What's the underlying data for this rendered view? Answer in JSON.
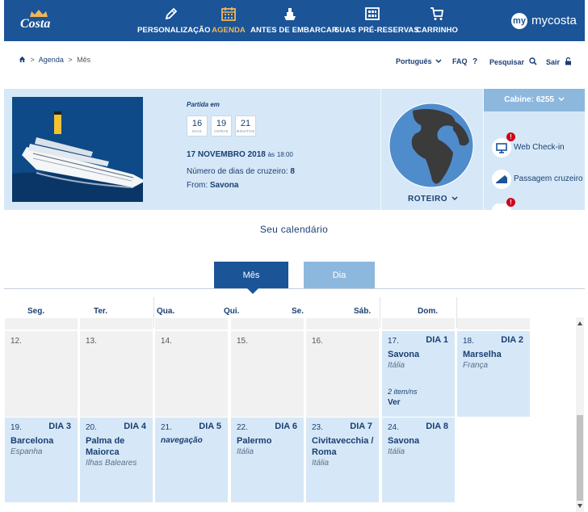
{
  "header": {
    "logo_text": "Costa",
    "nav": [
      {
        "label": "PERSONALIZAÇÃO",
        "icon": "pencil-icon"
      },
      {
        "label": "AGENDA",
        "icon": "calendar-icon",
        "active": true
      },
      {
        "label": "ANTES DE EMBARCAR",
        "icon": "ship-icon"
      },
      {
        "label": "SUAS PRÉ-RESERVAS",
        "icon": "grid-icon"
      },
      {
        "label": "CARRINHO",
        "icon": "cart-icon"
      }
    ],
    "mycosta_badge": "my",
    "mycosta_label": "mycosta"
  },
  "breadcrumb": {
    "home_icon": "home-icon",
    "items": [
      "Agenda",
      "Mês"
    ],
    "separator": ">"
  },
  "utility": {
    "language": "Português",
    "faq": "FAQ",
    "search": "Pesquisar",
    "logout": "Sair"
  },
  "cruise": {
    "departure_label": "Partida em",
    "countdown": [
      {
        "value": "16",
        "unit": "DIAS"
      },
      {
        "value": "19",
        "unit": "HORAS"
      },
      {
        "value": "21",
        "unit": "MINUTOS"
      }
    ],
    "date": "17 NOVEMBRO 2018",
    "time_prefix": "às",
    "time": "18:00",
    "days_label": "Número de dias de cruzeiro:",
    "days_value": "8",
    "from_label": "From:",
    "from_value": "Savona",
    "route_label": "ROTEIRO"
  },
  "cabin": {
    "title": "Cabine: 6255",
    "items": [
      {
        "label": "Web Check-in",
        "icon": "monitor-icon",
        "alert": "!"
      },
      {
        "label": "Passagem cruzeiro",
        "icon": "ticket-icon"
      },
      {
        "label": "",
        "icon": "document-icon",
        "alert": "!"
      }
    ]
  },
  "calendar": {
    "title": "Seu calendário",
    "tabs": [
      "Mês",
      "Dia"
    ],
    "weekdays": [
      "Seg.",
      "Ter.",
      "Qua.",
      "Qui.",
      "Se.",
      "Sáb.",
      "Dom."
    ],
    "week1": [
      {
        "date": "12."
      },
      {
        "date": "13."
      },
      {
        "date": "14."
      },
      {
        "date": "15."
      },
      {
        "date": "16."
      },
      {
        "date": "17.",
        "day": "DIA 1",
        "city": "Savona",
        "country": "Itália",
        "items": "2 item/ns",
        "link": "Ver"
      },
      {
        "date": "18.",
        "day": "DIA 2",
        "city": "Marselha",
        "country": "França"
      }
    ],
    "week2": [
      {
        "date": "19.",
        "day": "DIA 3",
        "city": "Barcelona",
        "country": "Espanha"
      },
      {
        "date": "20.",
        "day": "DIA 4",
        "city": "Palma de Maiorca",
        "country": "Ilhas Baleares"
      },
      {
        "date": "21.",
        "day": "DIA 5",
        "note": "navegação"
      },
      {
        "date": "22.",
        "day": "DIA 6",
        "city": "Palermo",
        "country": "Itália"
      },
      {
        "date": "23.",
        "day": "DIA 7",
        "city": "Civitavecchia / Roma",
        "country": "Itália"
      },
      {
        "date": "24.",
        "day": "DIA 8",
        "city": "Savona",
        "country": "Itália"
      }
    ]
  },
  "colors": {
    "primary": "#1b5497",
    "accent": "#f0b55a",
    "panel": "#d6e8f7",
    "alert": "#d0021b"
  }
}
